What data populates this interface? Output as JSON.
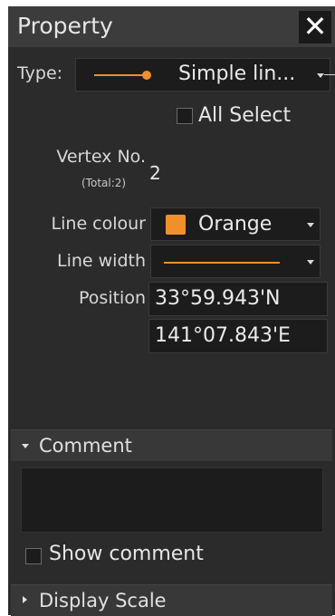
{
  "title": "Property",
  "type": {
    "label": "Type:",
    "value": "Simple lin..."
  },
  "all_select": {
    "label": "All Select",
    "checked": false
  },
  "vertex": {
    "label": "Vertex No.",
    "total": "(Total:2)",
    "value": "2"
  },
  "line_colour": {
    "label": "Line colour",
    "value": "Orange",
    "swatch": "#f0902a"
  },
  "line_width": {
    "label": "Line width",
    "line_color": "#f0902a"
  },
  "position": {
    "label": "Position",
    "lat": "33°59.943'N",
    "lon": "141°07.843'E"
  },
  "comment": {
    "header": "Comment",
    "text": ""
  },
  "show_comment": {
    "label": "Show comment",
    "checked": false
  },
  "display_scale": {
    "header": "Display Scale"
  },
  "colors": {
    "accent": "#f0902a",
    "panel": "#2b2b2b",
    "field": "#1c1c1c"
  }
}
